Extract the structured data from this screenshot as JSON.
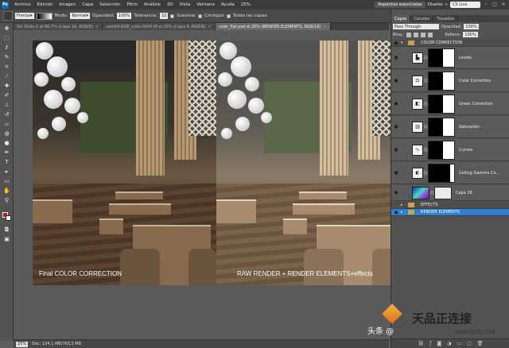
{
  "menubar": {
    "logo": "Ps",
    "items": [
      "Archivo",
      "Edición",
      "Imagen",
      "Capa",
      "Selección",
      "Filtro",
      "Análisis",
      "3D",
      "Vista",
      "Ventana",
      "Ayuda"
    ],
    "zoom_hint": "25%",
    "workspace_active": "Aspectos esenciales",
    "workspace_other": "Diseño",
    "search_placeholder": "CS Live"
  },
  "options": {
    "preset": "Frontal",
    "mode_label": "Modo:",
    "mode_value": "Normal",
    "opacity_label": "Opacidad:",
    "opacity_value": "100%",
    "tolerance_label": "Tolerancia:",
    "tolerance_value": "32",
    "smooth_label": "Suavizar",
    "contiguous_label": "Contiguo",
    "all_layers_label": "Todas las capas"
  },
  "tabs": [
    {
      "label": "Sin título-1 al 66,7% (Capa 16, RGB/8)",
      "active": false
    },
    {
      "label": "cam04,RGB_color.0000.tif al 25% (Capa 4, RGB/8)",
      "active": false
    },
    {
      "label": "color_flat.psd al 25% (RENDER ELEMENTS, RGB/16)",
      "active": true
    }
  ],
  "canvas": {
    "left_caption": "Final COLOR CORRECTION",
    "right_caption": "RAW RENDER + RENDER ELEMENTS+effects"
  },
  "status": {
    "zoom": "25%",
    "doc_info": "Doc: 104,1 MB/763,3 MB"
  },
  "panel": {
    "tabs": [
      "Capas",
      "Canales",
      "Trazados"
    ],
    "blend_mode": "Pass Through",
    "opacity_label": "Opacidad:",
    "opacity_value": "100%",
    "lock_label": "Bloq.:",
    "fill_label": "Relleno:",
    "fill_value": "100%",
    "groups": {
      "color_correction": "COLOR CORRECTION",
      "effects": "EFFECTS",
      "render_elements": "RENDER ELEMENTS"
    },
    "layers": [
      {
        "name": "Levels",
        "mask_black": 0.55
      },
      {
        "name": "Color Correction",
        "mask_black": 0.55
      },
      {
        "name": "Green Correction",
        "mask_black": 0.55
      },
      {
        "name": "Saturation",
        "mask_black": 0.55
      },
      {
        "name": "Curves",
        "mask_black": 0.55
      },
      {
        "name": "Ceiling Gamma Co...",
        "mask_black": 0.85
      }
    ],
    "pixel_layer": "Capa 28"
  },
  "watermark": {
    "big_text": "天品正连接",
    "url": "www.tpzlj.com",
    "toutiao": "头条 @"
  },
  "colors": {
    "foreground": "#c8141f",
    "background": "#ffffff",
    "selection": "#2f7fd5"
  }
}
